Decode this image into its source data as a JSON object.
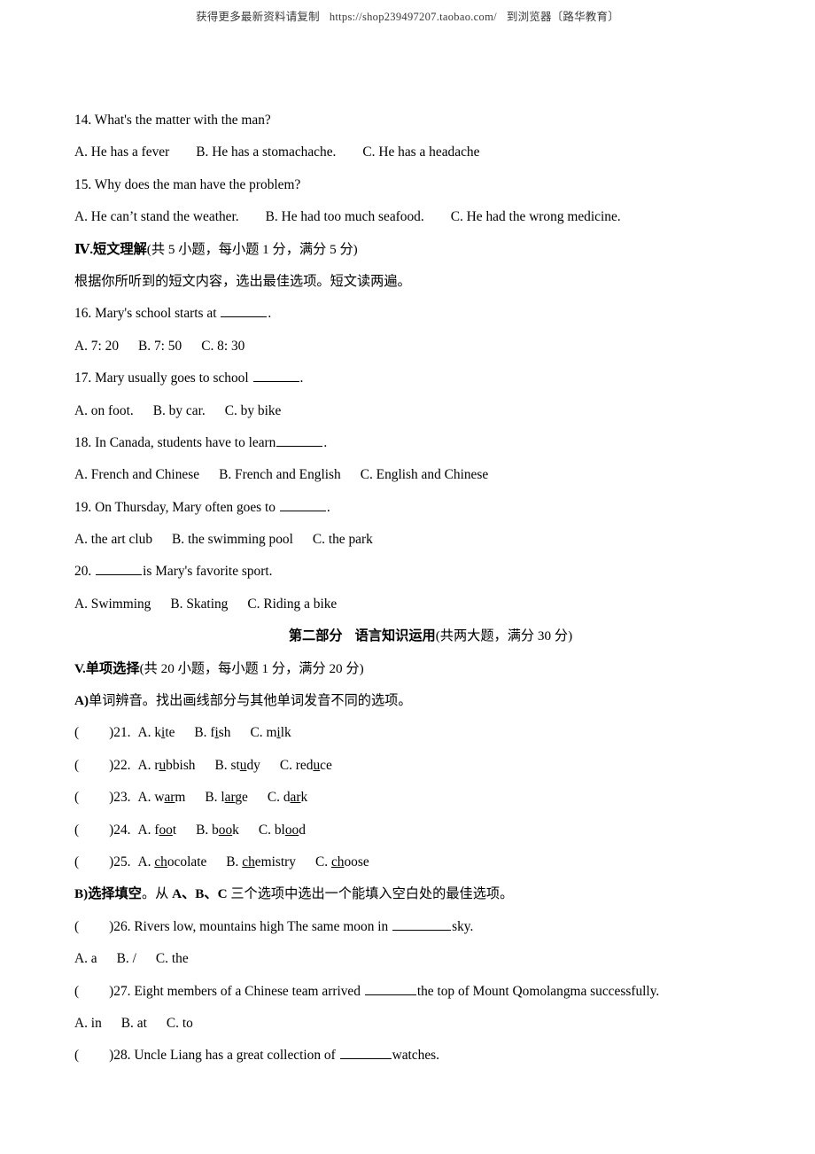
{
  "watermark": {
    "lead": "获得更多最新资料请复制",
    "url": "https://shop239497207.taobao.com/",
    "trail": "到浏览器〔路华教育〕"
  },
  "content": {
    "q14": {
      "stem": "14. What's the matter with the man?",
      "a": "A. He has a fever",
      "b": "B. He has a stomachache.",
      "c": "C. He has a headache"
    },
    "q15": {
      "stem": "15. Why does the man have the problem?",
      "a": "A. He can’t stand the weather.",
      "b": "B. He had too much seafood.",
      "c": "C. He had the wrong medicine."
    },
    "section4": {
      "label": "Ⅳ.短文理解",
      "points": "(共 5 小题，每小题 1 分，满分 5 分)",
      "instruction": "根据你所听到的短文内容，选出最佳选项。短文读两遍。"
    },
    "q16": {
      "stem_before": "16. Mary's school starts at",
      "stem_after": ".",
      "a": "A. 7: 20",
      "b": "B. 7: 50",
      "c": "C. 8: 30"
    },
    "q17": {
      "stem_before": "17. Mary usually goes to school",
      "stem_after": ".",
      "a": "A. on foot.",
      "b": "B. by car.",
      "c": "C. by bike"
    },
    "q18": {
      "stem_before": "18. In Canada, students have to learn",
      "stem_after": ".",
      "a": "A. French and Chinese",
      "b": "B. French and English",
      "c": "C. English and Chinese"
    },
    "q19": {
      "stem_before": "19. On Thursday, Mary often goes to",
      "stem_after": ".",
      "a": "A. the art club",
      "b": "B. the swimming pool",
      "c": "C. the park"
    },
    "q20": {
      "stem_before": "20.",
      "stem_after": "is Mary's favorite sport.",
      "a": "A. Swimming",
      "b": "B. Skating",
      "c": "C. Riding a bike"
    },
    "part2": {
      "title_a": "第二部分",
      "title_b": "语言知识运用",
      "points": "(共两大题，满分 30 分)"
    },
    "section5": {
      "label": "V.单项选择",
      "points": "(共 20 小题，每小题 1 分，满分 20 分)"
    },
    "sub_a": {
      "label": "A)",
      "text": "单词辨音。找出画线部分与其他单词发音不同的选项。"
    },
    "q21": {
      "num": ")21.",
      "a": {
        "prefix": "A. k",
        "ul": "i",
        "suffix": "te"
      },
      "b": {
        "prefix": "B. f",
        "ul": "i",
        "suffix": "sh"
      },
      "c": {
        "prefix": "C. m",
        "ul": "i",
        "suffix": "lk"
      }
    },
    "q22": {
      "num": ")22.",
      "a": {
        "prefix": "A. r",
        "ul": "u",
        "suffix": "bbish"
      },
      "b": {
        "prefix": "B. st",
        "ul": "u",
        "suffix": "dy"
      },
      "c": {
        "prefix": "C. red",
        "ul": "u",
        "suffix": "ce"
      }
    },
    "q23": {
      "num": ")23.",
      "a": {
        "prefix": "A. w",
        "ul": "ar",
        "suffix": "m"
      },
      "b": {
        "prefix": "B. l",
        "ul": "ar",
        "suffix": "ge"
      },
      "c": {
        "prefix": "C. d",
        "ul": "ar",
        "suffix": "k"
      }
    },
    "q24": {
      "num": ")24.",
      "a": {
        "prefix": "A. f",
        "ul": "oo",
        "suffix": "t"
      },
      "b": {
        "prefix": "B. b",
        "ul": "oo",
        "suffix": "k"
      },
      "c": {
        "prefix": "C. bl",
        "ul": "oo",
        "suffix": "d"
      }
    },
    "q25": {
      "num": ")25.",
      "a": {
        "prefix": "A. ",
        "ul": "ch",
        "suffix": "ocolate"
      },
      "b": {
        "prefix": "B. ",
        "ul": "ch",
        "suffix": "emistry"
      },
      "c": {
        "prefix": "C. ",
        "ul": "ch",
        "suffix": "oose"
      }
    },
    "sub_b": {
      "label": "B)选择填空",
      "t1": "。从 ",
      "opts": "A、B、C",
      "t2": " 三个选项中选出一个能填入空白处的最佳选项。"
    },
    "q26": {
      "num": ")26.",
      "stem_before": "Rivers low, mountains high The same moon in",
      "stem_after": "sky.",
      "a": "A. a",
      "b": "B. /",
      "c": "C. the"
    },
    "q27": {
      "num": ")27.",
      "stem_before": "Eight members of a Chinese team arrived",
      "stem_after": "the top of Mount Qomolangma successfully.",
      "a": "A. in",
      "b": "B. at",
      "c": "C. to"
    },
    "q28": {
      "num": ")28.",
      "stem_before": "Uncle Liang has a great collection of",
      "stem_after": "watches."
    }
  }
}
